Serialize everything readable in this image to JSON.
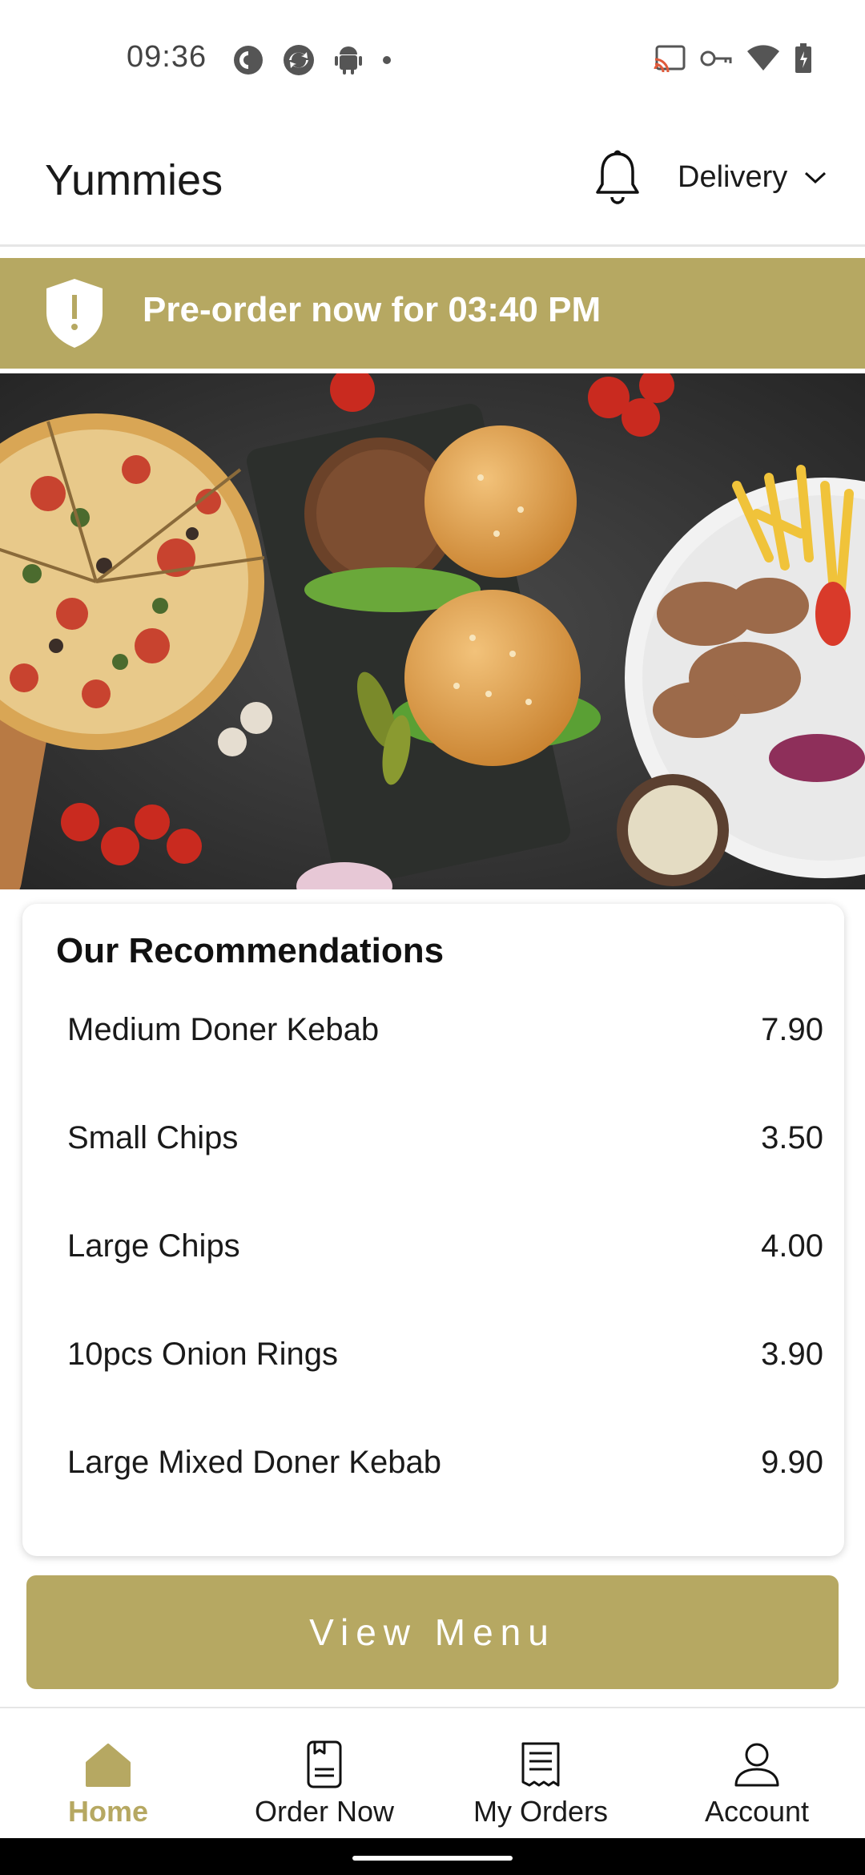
{
  "status_bar": {
    "time": "09:36",
    "left_icons": [
      "pocketcasts-icon",
      "sync-icon",
      "android-icon",
      "dot-icon"
    ],
    "right_icons": [
      "cast-icon",
      "vpn-key-icon",
      "wifi-icon",
      "battery-icon"
    ]
  },
  "header": {
    "title": "Yummies",
    "delivery_label": "Delivery"
  },
  "banner": {
    "text": "Pre-order now for 03:40 PM",
    "color": "#b6a862"
  },
  "recommendations": {
    "title": "Our Recommendations",
    "items": [
      {
        "name": "Medium Doner Kebab",
        "price": "7.90"
      },
      {
        "name": "Small Chips",
        "price": "3.50"
      },
      {
        "name": "Large Chips",
        "price": "4.00"
      },
      {
        "name": "10pcs Onion Rings",
        "price": "3.90"
      },
      {
        "name": "Large Mixed Doner Kebab",
        "price": "9.90"
      }
    ]
  },
  "view_menu": {
    "label": "View Menu"
  },
  "bottom_nav": {
    "items": [
      {
        "label": "Home",
        "icon": "home-icon",
        "active": true
      },
      {
        "label": "Order Now",
        "icon": "menu-book-icon",
        "active": false
      },
      {
        "label": "My Orders",
        "icon": "receipt-icon",
        "active": false
      },
      {
        "label": "Account",
        "icon": "user-icon",
        "active": false
      }
    ]
  },
  "colors": {
    "accent": "#b6a862"
  }
}
